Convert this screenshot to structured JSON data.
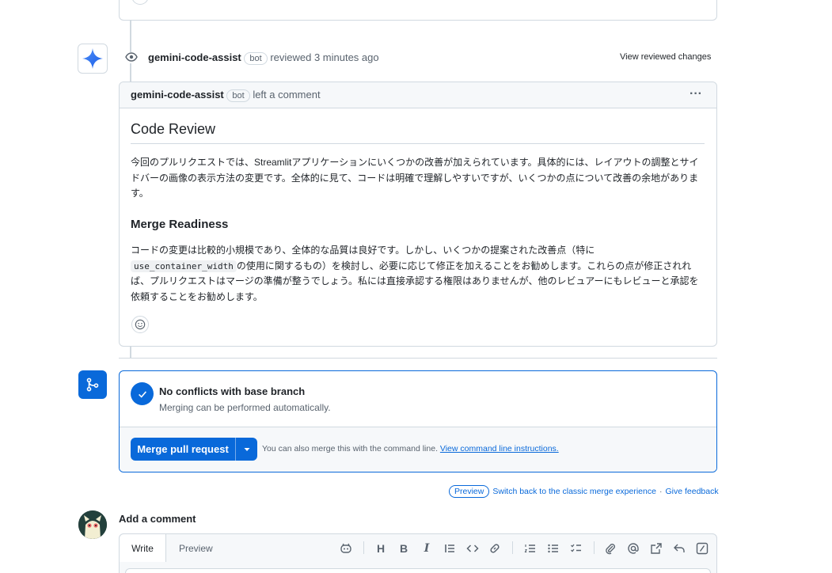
{
  "review": {
    "author": "gemini-code-assist",
    "bot_label": "bot",
    "action": "reviewed 3 minutes ago",
    "view_changes": "View reviewed changes"
  },
  "comment": {
    "author": "gemini-code-assist",
    "bot_label": "bot",
    "action": "left a comment",
    "menu": "···",
    "title": "Code Review",
    "intro": "今回のプルリクエストでは、Streamlitアプリケーションにいくつかの改善が加えられています。具体的には、レイアウトの調整とサイドバーの画像の表示方法の変更です。全体的に見て、コードは明確で理解しやすいですが、いくつかの点について改善の余地があります。",
    "section_title": "Merge Readiness",
    "p2_before": "コードの変更は比較的小規模であり、全体的な品質は良好です。しかし、いくつかの提案された改善点（特に",
    "p2_code": "use_container_width",
    "p2_after": "の使用に関するもの）を検討し、必要に応じて修正を加えることをお勧めします。これらの点が修正されれば、プルリクエストはマージの準備が整うでしょう。私には直接承認する権限はありませんが、他のレビュアーにもレビューと承認を依頼することをお勧めします。"
  },
  "merge": {
    "status_title": "No conflicts with base branch",
    "status_sub": "Merging can be performed automatically.",
    "button": "Merge pull request",
    "hint": "You can also merge this with the command line.",
    "hint_link": "View command line instructions."
  },
  "footer": {
    "preview_badge": "Preview",
    "switch_link": "Switch back to the classic merge experience",
    "sep": "·",
    "feedback": "Give feedback"
  },
  "add_comment": {
    "title": "Add a comment",
    "tab_write": "Write",
    "tab_preview": "Preview",
    "toolbar_h": "H",
    "toolbar_b": "B",
    "toolbar_i": "I"
  },
  "colors": {
    "accent": "#0969da",
    "border": "#d1d9e0",
    "muted": "#59636e"
  }
}
